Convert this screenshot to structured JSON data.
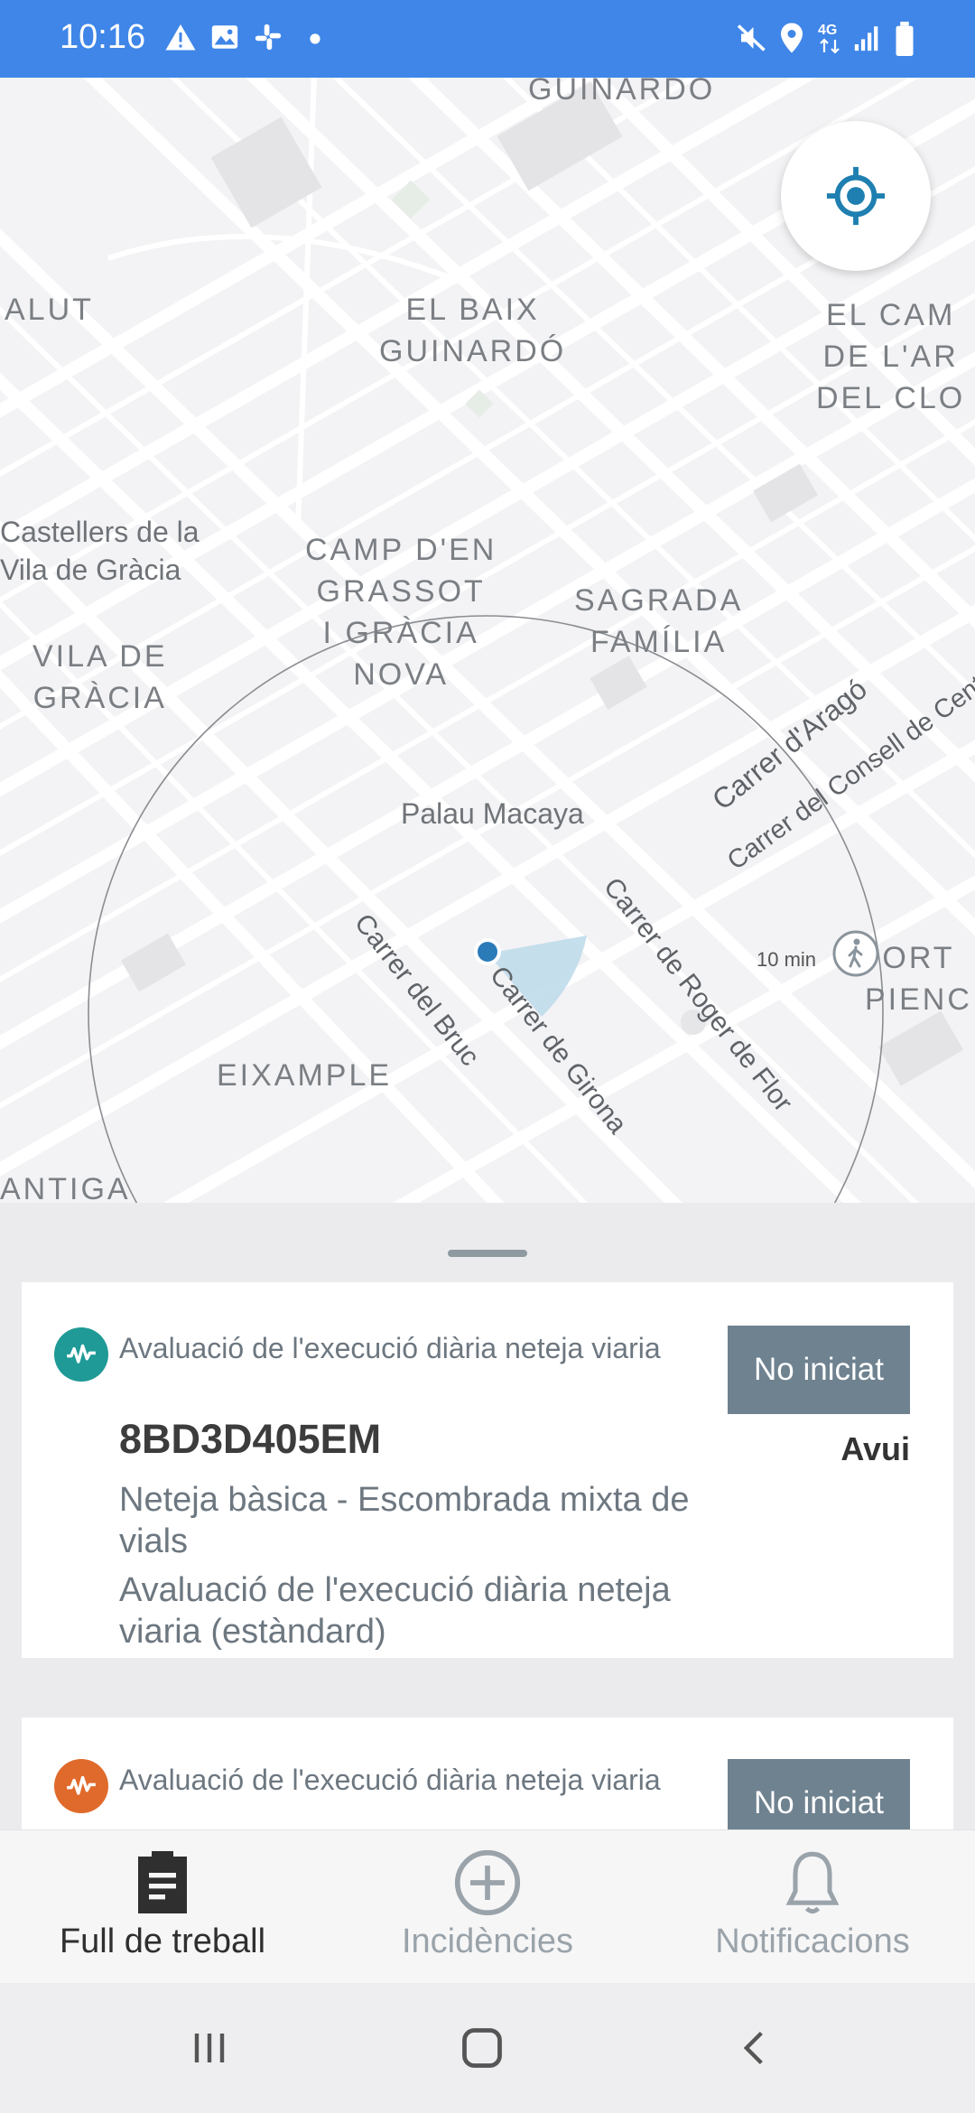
{
  "status_bar": {
    "time": "10:16",
    "left_icons": [
      "warning-icon",
      "image-icon",
      "slack-icon",
      "dot-icon"
    ],
    "right_icons": [
      "mute-icon",
      "location-icon",
      "4g-icon",
      "signal-icon",
      "battery-icon"
    ]
  },
  "map": {
    "area_labels": [
      "GUINARDÓ",
      "ALUT",
      "EL BAIX\nGUINARDÓ",
      "EL CAM\nDE L'AR\nDEL CLO",
      "CAMP D'EN\nGRASSOT\nI GRÀCIA\nNOVA",
      "SAGRADA\nFAMÍLIA",
      "VILA DE\nGRÀCIA",
      "EIXAMPLE",
      "ORT\nPIENC",
      "ANTIGA"
    ],
    "poi_labels": [
      "Castellers de la\nVila de Gràcia",
      "Palau Macaya"
    ],
    "streets": [
      "Carrer d'Aragó",
      "Carrer del Consell de Cent",
      "Carrer de Roger de Flor",
      "Carrer del Bruc",
      "Carrer de Girona"
    ],
    "walk_time": "10 min",
    "walk_icon": "pedestrian-icon",
    "locate_icon": "crosshair-icon",
    "accent": "#2b7bb9"
  },
  "tasks": [
    {
      "type": "Avaluació de l'execució diària neteja viaria",
      "code": "8BD3D405EM",
      "line1": "Neteja bàsica - Escombrada mixta de vials",
      "line2": "Avaluació de l'execució diària neteja viaria (estàndard)",
      "status": "No iniciat",
      "when": "Avui",
      "badge_color": "#1f9a96"
    },
    {
      "type": "Avaluació de l'execució diària neteja viaria",
      "status": "No iniciat",
      "badge_color": "#e06a2b"
    }
  ],
  "bottom_nav": {
    "items": [
      {
        "label": "Full de treball",
        "icon": "clipboard-icon",
        "active": true
      },
      {
        "label": "Incidències",
        "icon": "add-circle-icon",
        "active": false
      },
      {
        "label": "Notificacions",
        "icon": "bell-icon",
        "active": false
      }
    ],
    "active_color": "#2f2f2f",
    "inactive_color": "#9aa3aa"
  },
  "system_nav": [
    "recents-icon",
    "home-icon",
    "back-icon"
  ]
}
